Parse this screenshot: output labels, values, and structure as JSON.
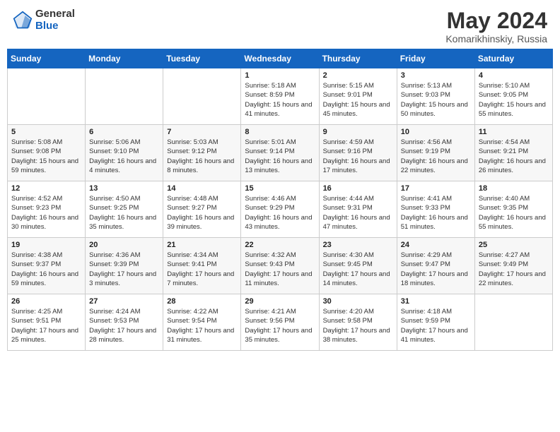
{
  "header": {
    "logo_general": "General",
    "logo_blue": "Blue",
    "title": "May 2024",
    "subtitle": "Komarikhinskiy, Russia"
  },
  "weekdays": [
    "Sunday",
    "Monday",
    "Tuesday",
    "Wednesday",
    "Thursday",
    "Friday",
    "Saturday"
  ],
  "weeks": [
    [
      {
        "day": "",
        "sunrise": "",
        "sunset": "",
        "daylight": ""
      },
      {
        "day": "",
        "sunrise": "",
        "sunset": "",
        "daylight": ""
      },
      {
        "day": "",
        "sunrise": "",
        "sunset": "",
        "daylight": ""
      },
      {
        "day": "1",
        "sunrise": "Sunrise: 5:18 AM",
        "sunset": "Sunset: 8:59 PM",
        "daylight": "Daylight: 15 hours and 41 minutes."
      },
      {
        "day": "2",
        "sunrise": "Sunrise: 5:15 AM",
        "sunset": "Sunset: 9:01 PM",
        "daylight": "Daylight: 15 hours and 45 minutes."
      },
      {
        "day": "3",
        "sunrise": "Sunrise: 5:13 AM",
        "sunset": "Sunset: 9:03 PM",
        "daylight": "Daylight: 15 hours and 50 minutes."
      },
      {
        "day": "4",
        "sunrise": "Sunrise: 5:10 AM",
        "sunset": "Sunset: 9:05 PM",
        "daylight": "Daylight: 15 hours and 55 minutes."
      }
    ],
    [
      {
        "day": "5",
        "sunrise": "Sunrise: 5:08 AM",
        "sunset": "Sunset: 9:08 PM",
        "daylight": "Daylight: 15 hours and 59 minutes."
      },
      {
        "day": "6",
        "sunrise": "Sunrise: 5:06 AM",
        "sunset": "Sunset: 9:10 PM",
        "daylight": "Daylight: 16 hours and 4 minutes."
      },
      {
        "day": "7",
        "sunrise": "Sunrise: 5:03 AM",
        "sunset": "Sunset: 9:12 PM",
        "daylight": "Daylight: 16 hours and 8 minutes."
      },
      {
        "day": "8",
        "sunrise": "Sunrise: 5:01 AM",
        "sunset": "Sunset: 9:14 PM",
        "daylight": "Daylight: 16 hours and 13 minutes."
      },
      {
        "day": "9",
        "sunrise": "Sunrise: 4:59 AM",
        "sunset": "Sunset: 9:16 PM",
        "daylight": "Daylight: 16 hours and 17 minutes."
      },
      {
        "day": "10",
        "sunrise": "Sunrise: 4:56 AM",
        "sunset": "Sunset: 9:19 PM",
        "daylight": "Daylight: 16 hours and 22 minutes."
      },
      {
        "day": "11",
        "sunrise": "Sunrise: 4:54 AM",
        "sunset": "Sunset: 9:21 PM",
        "daylight": "Daylight: 16 hours and 26 minutes."
      }
    ],
    [
      {
        "day": "12",
        "sunrise": "Sunrise: 4:52 AM",
        "sunset": "Sunset: 9:23 PM",
        "daylight": "Daylight: 16 hours and 30 minutes."
      },
      {
        "day": "13",
        "sunrise": "Sunrise: 4:50 AM",
        "sunset": "Sunset: 9:25 PM",
        "daylight": "Daylight: 16 hours and 35 minutes."
      },
      {
        "day": "14",
        "sunrise": "Sunrise: 4:48 AM",
        "sunset": "Sunset: 9:27 PM",
        "daylight": "Daylight: 16 hours and 39 minutes."
      },
      {
        "day": "15",
        "sunrise": "Sunrise: 4:46 AM",
        "sunset": "Sunset: 9:29 PM",
        "daylight": "Daylight: 16 hours and 43 minutes."
      },
      {
        "day": "16",
        "sunrise": "Sunrise: 4:44 AM",
        "sunset": "Sunset: 9:31 PM",
        "daylight": "Daylight: 16 hours and 47 minutes."
      },
      {
        "day": "17",
        "sunrise": "Sunrise: 4:41 AM",
        "sunset": "Sunset: 9:33 PM",
        "daylight": "Daylight: 16 hours and 51 minutes."
      },
      {
        "day": "18",
        "sunrise": "Sunrise: 4:40 AM",
        "sunset": "Sunset: 9:35 PM",
        "daylight": "Daylight: 16 hours and 55 minutes."
      }
    ],
    [
      {
        "day": "19",
        "sunrise": "Sunrise: 4:38 AM",
        "sunset": "Sunset: 9:37 PM",
        "daylight": "Daylight: 16 hours and 59 minutes."
      },
      {
        "day": "20",
        "sunrise": "Sunrise: 4:36 AM",
        "sunset": "Sunset: 9:39 PM",
        "daylight": "Daylight: 17 hours and 3 minutes."
      },
      {
        "day": "21",
        "sunrise": "Sunrise: 4:34 AM",
        "sunset": "Sunset: 9:41 PM",
        "daylight": "Daylight: 17 hours and 7 minutes."
      },
      {
        "day": "22",
        "sunrise": "Sunrise: 4:32 AM",
        "sunset": "Sunset: 9:43 PM",
        "daylight": "Daylight: 17 hours and 11 minutes."
      },
      {
        "day": "23",
        "sunrise": "Sunrise: 4:30 AM",
        "sunset": "Sunset: 9:45 PM",
        "daylight": "Daylight: 17 hours and 14 minutes."
      },
      {
        "day": "24",
        "sunrise": "Sunrise: 4:29 AM",
        "sunset": "Sunset: 9:47 PM",
        "daylight": "Daylight: 17 hours and 18 minutes."
      },
      {
        "day": "25",
        "sunrise": "Sunrise: 4:27 AM",
        "sunset": "Sunset: 9:49 PM",
        "daylight": "Daylight: 17 hours and 22 minutes."
      }
    ],
    [
      {
        "day": "26",
        "sunrise": "Sunrise: 4:25 AM",
        "sunset": "Sunset: 9:51 PM",
        "daylight": "Daylight: 17 hours and 25 minutes."
      },
      {
        "day": "27",
        "sunrise": "Sunrise: 4:24 AM",
        "sunset": "Sunset: 9:53 PM",
        "daylight": "Daylight: 17 hours and 28 minutes."
      },
      {
        "day": "28",
        "sunrise": "Sunrise: 4:22 AM",
        "sunset": "Sunset: 9:54 PM",
        "daylight": "Daylight: 17 hours and 31 minutes."
      },
      {
        "day": "29",
        "sunrise": "Sunrise: 4:21 AM",
        "sunset": "Sunset: 9:56 PM",
        "daylight": "Daylight: 17 hours and 35 minutes."
      },
      {
        "day": "30",
        "sunrise": "Sunrise: 4:20 AM",
        "sunset": "Sunset: 9:58 PM",
        "daylight": "Daylight: 17 hours and 38 minutes."
      },
      {
        "day": "31",
        "sunrise": "Sunrise: 4:18 AM",
        "sunset": "Sunset: 9:59 PM",
        "daylight": "Daylight: 17 hours and 41 minutes."
      },
      {
        "day": "",
        "sunrise": "",
        "sunset": "",
        "daylight": ""
      }
    ]
  ]
}
